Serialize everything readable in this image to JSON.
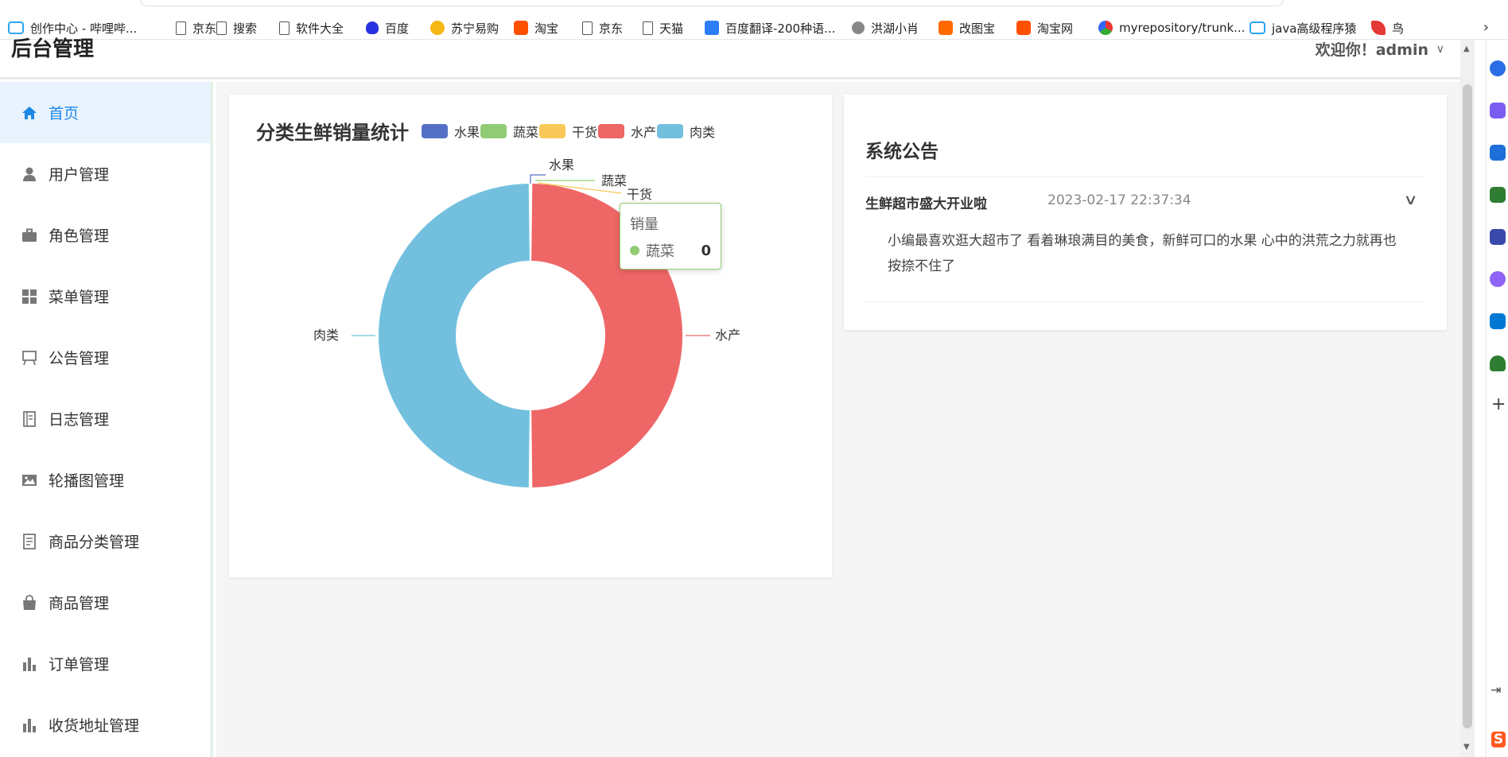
{
  "bookmarks": [
    {
      "label": "创作中心 - 哔哩哔...",
      "icon": "bilibili-icon"
    },
    {
      "label": "京东",
      "icon": "page-icon"
    },
    {
      "label": "搜索",
      "icon": "page-icon"
    },
    {
      "label": "软件大全",
      "icon": "page-icon"
    },
    {
      "label": "百度",
      "icon": "baidu-icon"
    },
    {
      "label": "苏宁易购",
      "icon": "suning-icon"
    },
    {
      "label": "淘宝",
      "icon": "taobao-icon"
    },
    {
      "label": "京东",
      "icon": "page-icon"
    },
    {
      "label": "天猫",
      "icon": "page-icon"
    },
    {
      "label": "百度翻译-200种语...",
      "icon": "translate-icon"
    },
    {
      "label": "洪湖小肖",
      "icon": "hh-icon"
    },
    {
      "label": "改图宝",
      "icon": "gaitubao-icon"
    },
    {
      "label": "淘宝网",
      "icon": "taobao-icon"
    },
    {
      "label": "myrepository/trunk...",
      "icon": "repo-icon"
    },
    {
      "label": "java高级程序猿",
      "icon": "bilibili-icon"
    },
    {
      "label": "鸟",
      "icon": "bird-icon"
    }
  ],
  "header": {
    "brand": "后台管理",
    "welcome": "欢迎你！admin"
  },
  "sidebar": {
    "items": [
      {
        "label": "首页",
        "icon": "home-icon",
        "active": true
      },
      {
        "label": "用户管理",
        "icon": "user-icon"
      },
      {
        "label": "角色管理",
        "icon": "briefcase-icon"
      },
      {
        "label": "菜单管理",
        "icon": "grid-icon"
      },
      {
        "label": "公告管理",
        "icon": "board-icon"
      },
      {
        "label": "日志管理",
        "icon": "notebook-icon"
      },
      {
        "label": "轮播图管理",
        "icon": "picture-icon"
      },
      {
        "label": "商品分类管理",
        "icon": "document-icon"
      },
      {
        "label": "商品管理",
        "icon": "bag-icon"
      },
      {
        "label": "订单管理",
        "icon": "bar-chart-icon"
      },
      {
        "label": "收货地址管理",
        "icon": "bar-chart-icon"
      }
    ]
  },
  "chart_card": {
    "title": "分类生鲜销量统计"
  },
  "chart_data": {
    "type": "pie",
    "style": "donut",
    "title": "分类生鲜销量统计",
    "series_name": "销量",
    "legend_position": "top-right",
    "categories": [
      "水果",
      "蔬菜",
      "干货",
      "水产",
      "肉类"
    ],
    "values": [
      0,
      0,
      0,
      1,
      1
    ],
    "colors": [
      "#5470c6",
      "#91cc75",
      "#fac858",
      "#ee6666",
      "#73c0de"
    ]
  },
  "tooltip": {
    "title": "销量",
    "item": "蔬菜",
    "value": "0"
  },
  "notice": {
    "title": "系统公告",
    "items": [
      {
        "title": "生鲜超市盛大开业啦",
        "time": "2023-02-17 22:37:34",
        "content": "小编最喜欢逛大超市了 看着琳琅满目的美食，新鲜可口的水果 心中的洪荒之力就再也按捺不住了"
      }
    ]
  }
}
